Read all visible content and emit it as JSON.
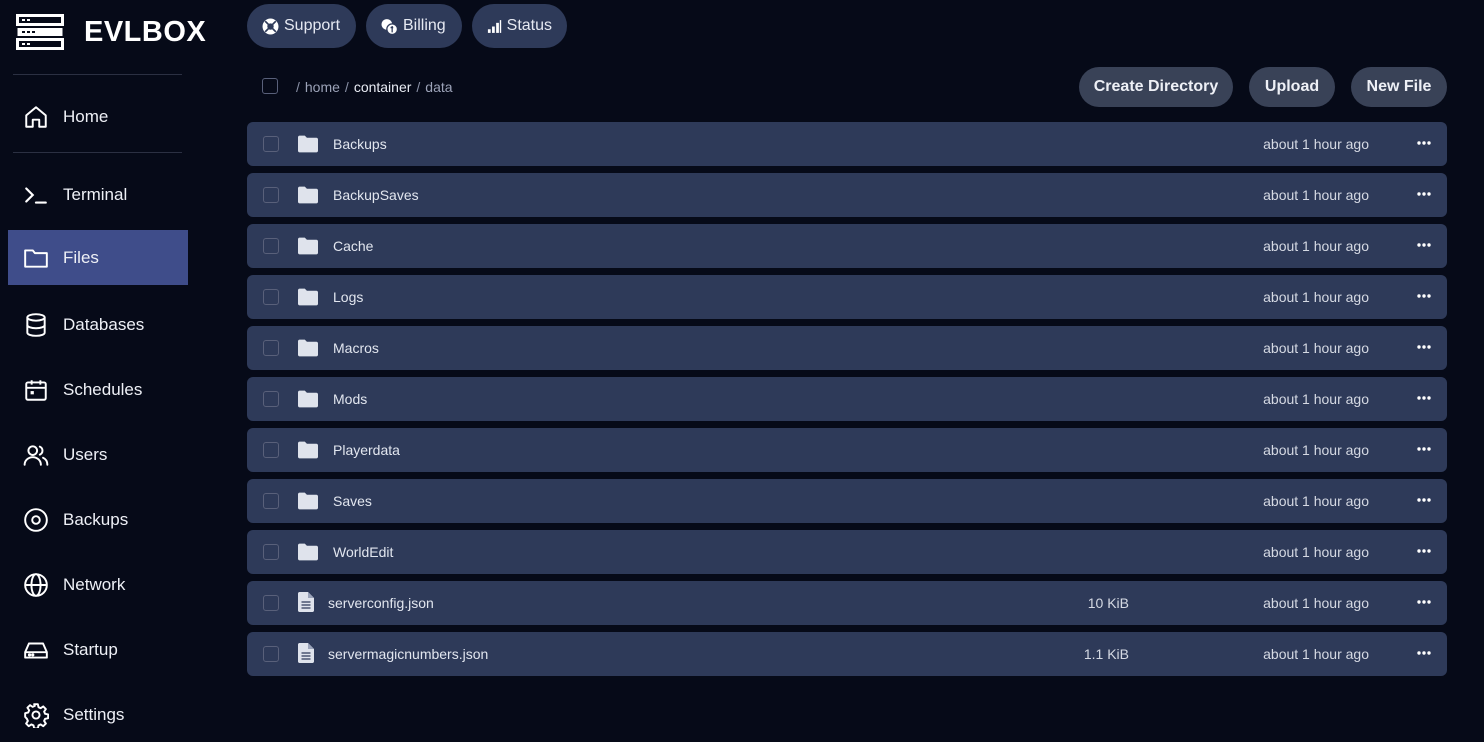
{
  "brand": {
    "name": "EVLBOX",
    "icon": "server-stack-icon"
  },
  "sidebar": {
    "items": [
      {
        "label": "Home",
        "icon": "home-icon"
      },
      {
        "label": "Terminal",
        "icon": "terminal-icon"
      },
      {
        "label": "Files",
        "icon": "folder-icon",
        "active": true
      },
      {
        "label": "Databases",
        "icon": "database-icon"
      },
      {
        "label": "Schedules",
        "icon": "calendar-icon"
      },
      {
        "label": "Users",
        "icon": "users-icon"
      },
      {
        "label": "Backups",
        "icon": "disc-icon"
      },
      {
        "label": "Network",
        "icon": "globe-icon"
      },
      {
        "label": "Startup",
        "icon": "hard-drive-icon"
      },
      {
        "label": "Settings",
        "icon": "gear-icon"
      }
    ]
  },
  "top_buttons": [
    {
      "label": "Support",
      "icon": "lifebuoy-icon"
    },
    {
      "label": "Billing",
      "icon": "coins-icon"
    },
    {
      "label": "Status",
      "icon": "bar-chart-icon"
    }
  ],
  "breadcrumb": {
    "separator": "/",
    "parts": [
      "home",
      "container",
      "data"
    ]
  },
  "actions": {
    "create_directory": "Create Directory",
    "upload": "Upload",
    "new_file": "New File"
  },
  "files": [
    {
      "name": "Backups",
      "type": "folder",
      "size": "",
      "modified": "about 1 hour ago"
    },
    {
      "name": "BackupSaves",
      "type": "folder",
      "size": "",
      "modified": "about 1 hour ago"
    },
    {
      "name": "Cache",
      "type": "folder",
      "size": "",
      "modified": "about 1 hour ago"
    },
    {
      "name": "Logs",
      "type": "folder",
      "size": "",
      "modified": "about 1 hour ago"
    },
    {
      "name": "Macros",
      "type": "folder",
      "size": "",
      "modified": "about 1 hour ago"
    },
    {
      "name": "Mods",
      "type": "folder",
      "size": "",
      "modified": "about 1 hour ago"
    },
    {
      "name": "Playerdata",
      "type": "folder",
      "size": "",
      "modified": "about 1 hour ago"
    },
    {
      "name": "Saves",
      "type": "folder",
      "size": "",
      "modified": "about 1 hour ago"
    },
    {
      "name": "WorldEdit",
      "type": "folder",
      "size": "",
      "modified": "about 1 hour ago"
    },
    {
      "name": "serverconfig.json",
      "type": "file",
      "size": "10 KiB",
      "modified": "about 1 hour ago"
    },
    {
      "name": "servermagicnumbers.json",
      "type": "file",
      "size": "1.1 KiB",
      "modified": "about 1 hour ago"
    }
  ],
  "colors": {
    "background": "#060a18",
    "row": "#2e3a59",
    "active_nav": "#3f4d8a",
    "button": "#394257"
  }
}
